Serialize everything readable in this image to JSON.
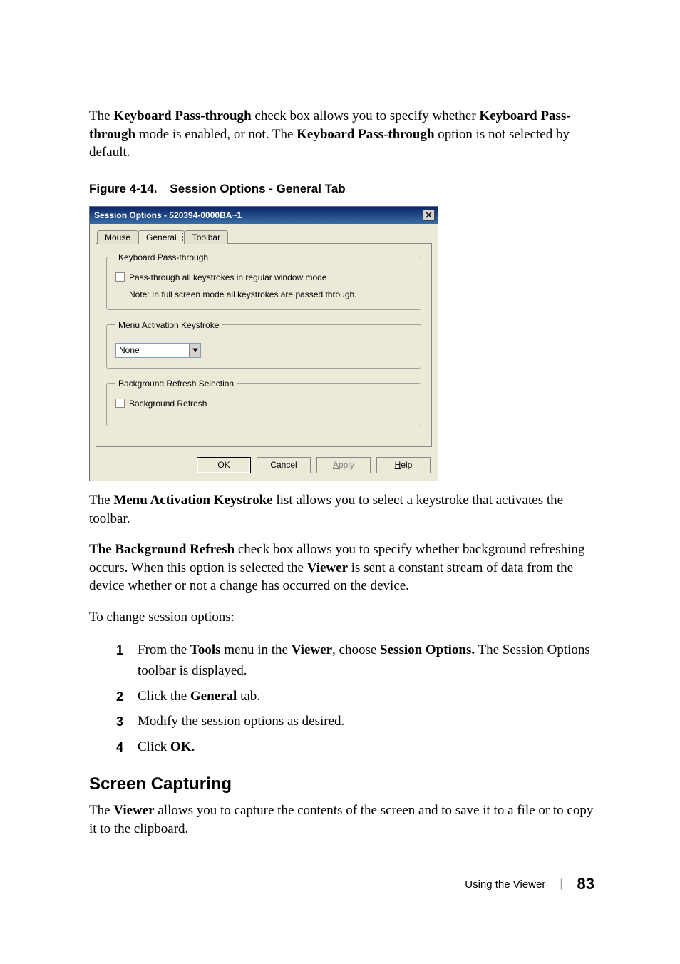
{
  "para1": {
    "t1": "The ",
    "b1": "Keyboard Pass-through",
    "t2": " check box allows you to specify whether ",
    "b2": "Keyboard Pass-through",
    "t3": " mode is enabled, or not. The ",
    "b3": "Keyboard Pass-through",
    "t4": " option is not selected by default."
  },
  "figure": {
    "num": "Figure 4-14.",
    "title": "Session Options - General Tab"
  },
  "dialog": {
    "title": "Session Options - 520394-0000BA~1",
    "tabs": {
      "mouse": "Mouse",
      "general": "General",
      "toolbar": "Toolbar"
    },
    "group1": {
      "legend": "Keyboard Pass-through",
      "cb": "Pass-through all keystrokes in regular window mode",
      "note": "Note: In full screen mode all keystrokes are passed through."
    },
    "group2": {
      "legend": "Menu Activation Keystroke",
      "value": "None"
    },
    "group3": {
      "legend": "Background Refresh Selection",
      "cb": "Background Refresh"
    },
    "buttons": {
      "ok": "OK",
      "cancel": "Cancel",
      "apply_A": "A",
      "apply_rest": "pply",
      "help_H": "H",
      "help_rest": "elp"
    }
  },
  "para2": {
    "t1": "The ",
    "b1": "Menu Activation Keystroke",
    "t2": " list allows you to select a keystroke that activates the toolbar."
  },
  "para3": {
    "b1": "The Background Refresh",
    "t1": " check box allows you to specify whether background refreshing occurs. When this option is selected the ",
    "b2": "Viewer",
    "t2": " is sent a constant stream of data from the device whether or not a change has occurred on the device."
  },
  "para4": "To change session options:",
  "steps": {
    "s1": {
      "num": "1",
      "t1": "From the ",
      "b1": "Tools",
      "t2": " menu in the ",
      "b2": "Viewer",
      "t3": ", choose ",
      "b3": "Session Options.",
      "t4": " The Session Options toolbar is displayed."
    },
    "s2": {
      "num": "2",
      "t1": "Click the ",
      "b1": "General",
      "t2": " tab."
    },
    "s3": {
      "num": "3",
      "t1": "Modify the session options as desired."
    },
    "s4": {
      "num": "4",
      "t1": "Click ",
      "b1": "OK."
    }
  },
  "section": "Screen Capturing",
  "para5": {
    "t1": "The ",
    "b1": "Viewer",
    "t2": " allows you to capture the contents of the screen and to save it to a file or to copy it to the clipboard."
  },
  "footer": {
    "label": "Using the Viewer",
    "page": "83"
  }
}
